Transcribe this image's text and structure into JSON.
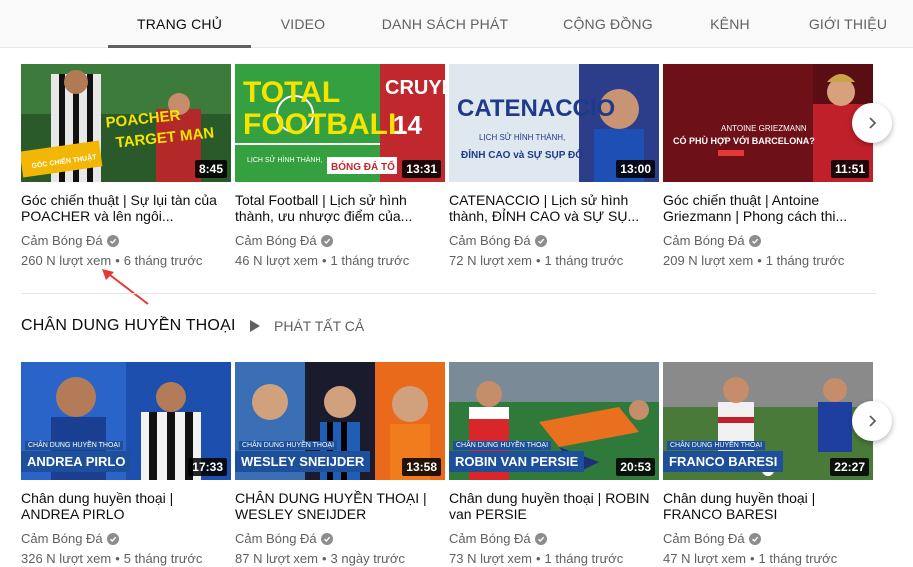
{
  "tabs": [
    {
      "label": "TRANG CHỦ"
    },
    {
      "label": "VIDEO"
    },
    {
      "label": "DANH SÁCH PHÁT"
    },
    {
      "label": "CỘNG ĐỒNG"
    },
    {
      "label": "KÊNH"
    },
    {
      "label": "GIỚI THIỆU"
    }
  ],
  "row1": [
    {
      "title": "Góc chiến thuật | Sự lụi tàn của POACHER và lên ngôi...",
      "channel": "Cảm Bóng Đá",
      "views": "260 N lượt xem",
      "age": "6 tháng trước",
      "duration": "8:45",
      "thumb_text": "POACHER\nTARGET MAN",
      "thumb_badge": "GÓC CHIẾN THUẬT"
    },
    {
      "title": "Total Football | Lịch sử hình thành, ưu nhược điểm của...",
      "channel": "Cảm Bóng Đá",
      "views": "46 N lượt xem",
      "age": "1 tháng trước",
      "duration": "13:31",
      "thumb_text": "TOTAL FOOTBALL",
      "thumb_badge": "BÓNG ĐÁ TỔ"
    },
    {
      "title": "CATENACCIO | Lịch sử hình thành, ĐỈNH CAO và SỰ SỤ...",
      "channel": "Cảm Bóng Đá",
      "views": "72 N lượt xem",
      "age": "1 tháng trước",
      "duration": "13:00",
      "thumb_text": "CATENACCIO",
      "thumb_badge": "ĐỈNH CAO và SỰ SỤP ĐỔ"
    },
    {
      "title": "Góc chiến thuật | Antoine Griezmann | Phong cách thi...",
      "channel": "Cảm Bóng Đá",
      "views": "209 N lượt xem",
      "age": "1 tháng trước",
      "duration": "11:51",
      "thumb_text": "ANTOINE GRIEZMANN",
      "thumb_badge": "CÓ PHÙ HỢP VỚI BARCELONA?"
    }
  ],
  "section": {
    "title": "CHÂN DUNG HUYỀN THOẠI",
    "play_all": "PHÁT TẤT CẢ"
  },
  "row2": [
    {
      "title": "Chân dung huyền thoại | ANDREA PIRLO",
      "channel": "Cảm Bóng Đá",
      "views": "326 N lượt xem",
      "age": "5 tháng trước",
      "duration": "17:33",
      "caption": "ANDREA PIRLO",
      "subcaption": "CHÂN DUNG HUYỀN THOẠI"
    },
    {
      "title": "CHÂN DUNG HUYỀN THOẠI | WESLEY SNEIJDER",
      "channel": "Cảm Bóng Đá",
      "views": "87 N lượt xem",
      "age": "3 ngày trước",
      "duration": "13:58",
      "caption": "WESLEY SNEIJDER",
      "subcaption": "CHÂN DUNG HUYỀN THOẠI"
    },
    {
      "title": "Chân dung huyền thoại | ROBIN van PERSIE",
      "channel": "Cảm Bóng Đá",
      "views": "73 N lượt xem",
      "age": "1 tháng trước",
      "duration": "20:53",
      "caption": "ROBIN VAN PERSIE",
      "subcaption": "CHÂN DUNG HUYỀN THOẠI"
    },
    {
      "title": "Chân dung huyền thoại | FRANCO BARESI",
      "channel": "Cảm Bóng Đá",
      "views": "47 N lượt xem",
      "age": "1 tháng trước",
      "duration": "22:27",
      "caption": "FRANCO BARESI",
      "subcaption": "CHÂN DUNG HUYỀN THOẠI"
    }
  ],
  "meta_separator": "•",
  "colors": {
    "accent_red": "#e53935",
    "text_secondary": "#606060"
  }
}
